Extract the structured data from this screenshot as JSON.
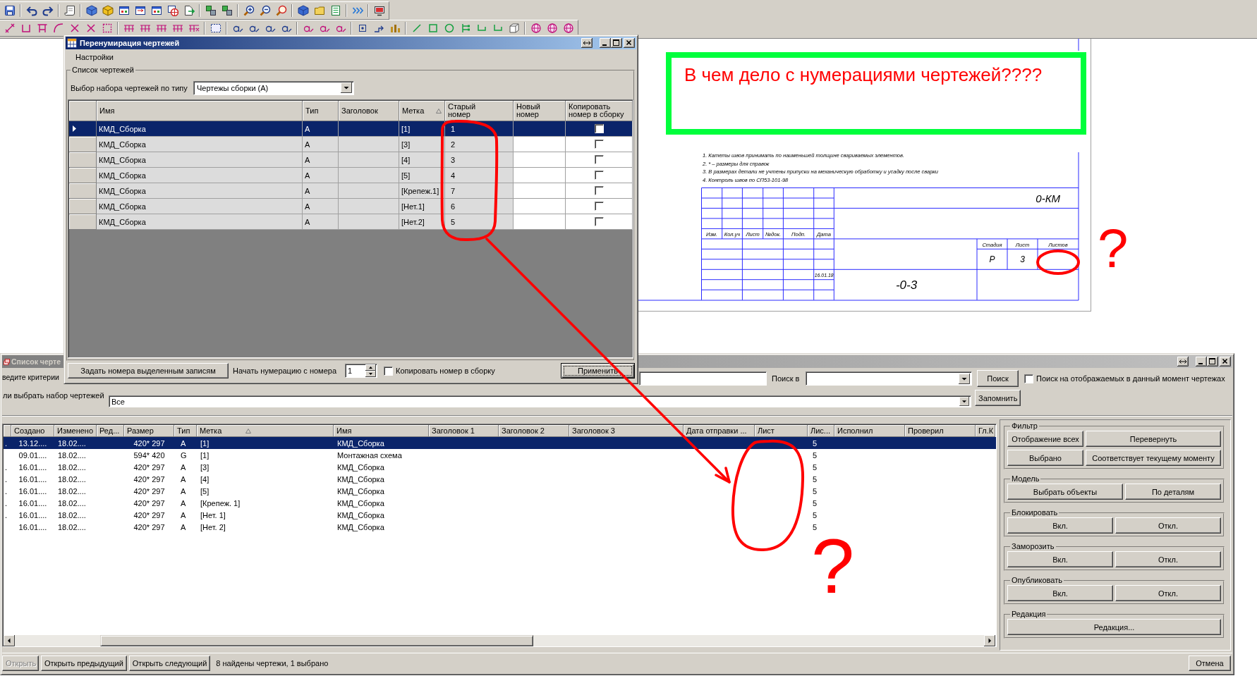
{
  "drawing_sheet": {
    "notes": [
      "1. Катеты швов принимать по наименьшей толщине свариваемых элементов.",
      "2. * – размеры для справок",
      "3. В размерах детали не учтены припуски на механическую обработку и усадку после сварки",
      "4. Контроль швов по СП53-101-98"
    ],
    "designation": "0-КМ",
    "revision_columns": [
      "Изм.",
      "Кол.уч",
      "Лист",
      "№док.",
      "Подп.",
      "Дата"
    ],
    "date": "16.01.18",
    "stage_columns": [
      "Стадия",
      "Лист",
      "Листов"
    ],
    "stage_values": [
      "Р",
      "3"
    ],
    "title": "-0-3"
  },
  "note": {
    "text": "В чем дело с нумерациями чертежей????"
  },
  "renumber_dialog": {
    "title": "Перенумирация чертежей",
    "active": true,
    "menu": [
      "Настройки"
    ],
    "group_title": "Список чертежей",
    "type_label": "Выбор набора чертежей по типу",
    "type_value": "Чертежы сборки (A)",
    "columns": [
      {
        "label": "Имя",
        "sorted": false
      },
      {
        "label": "Тип",
        "sorted": false
      },
      {
        "label": "Заголовок",
        "sorted": false
      },
      {
        "label": "Метка",
        "sorted": true
      },
      {
        "label": "Старый номер",
        "sorted": false
      },
      {
        "label": "Новый номер",
        "sorted": false
      },
      {
        "label": "Копировать номер в сборку",
        "sorted": false
      }
    ],
    "rows": [
      {
        "name": "КМД_Сборка",
        "type": "A",
        "label": "[1]",
        "old_number": "1",
        "copy": false,
        "selected": true
      },
      {
        "name": "КМД_Сборка",
        "type": "A",
        "label": "[3]",
        "old_number": "2",
        "copy": false,
        "selected": false
      },
      {
        "name": "КМД_Сборка",
        "type": "A",
        "label": "[4]",
        "old_number": "3",
        "copy": false,
        "selected": false
      },
      {
        "name": "КМД_Сборка",
        "type": "A",
        "label": "[5]",
        "old_number": "4",
        "copy": false,
        "selected": false
      },
      {
        "name": "КМД_Сборка",
        "type": "A",
        "label": "[Крепеж.1]",
        "old_number": "7",
        "copy": false,
        "selected": false
      },
      {
        "name": "КМД_Сборка",
        "type": "A",
        "label": "[Нет.1]",
        "old_number": "6",
        "copy": false,
        "selected": false
      },
      {
        "name": "КМД_Сборка",
        "type": "A",
        "label": "[Нет.2]",
        "old_number": "5",
        "copy": false,
        "selected": false
      }
    ],
    "assign_button": "Задать номера выделенным записям",
    "start_label": "Начать нумерацию с номера",
    "start_value": "1",
    "copy_option": {
      "label": "Копировать номер в сборку",
      "checked": false
    },
    "apply_button": {
      "label": "Применить",
      "focused": true
    }
  },
  "drawings_list": {
    "title": "Список черте",
    "active": false,
    "criteria_label": "ведите критерии",
    "search_in_label": "Поиск в",
    "search_button": "Поиск",
    "visible_only": {
      "label": "Поиск на отображаемых в данный момент чертежах",
      "checked": false
    },
    "set_label": "ли выбрать набор чертежей",
    "set_value": "Все",
    "remember_button": "Запомнить",
    "columns": [
      {
        "label": "Создано",
        "sorted": false
      },
      {
        "label": "Изменено",
        "sorted": false
      },
      {
        "label": "Ред...",
        "sorted": false
      },
      {
        "label": "Размер",
        "sorted": false
      },
      {
        "label": "Тип",
        "sorted": false
      },
      {
        "label": "Метка",
        "sorted": true
      },
      {
        "label": "Имя",
        "sorted": false
      },
      {
        "label": "Заголовок 1",
        "sorted": false
      },
      {
        "label": "Заголовок 2",
        "sorted": false
      },
      {
        "label": "Заголовок 3",
        "sorted": false
      },
      {
        "label": "Дата отправки ...",
        "sorted": false
      },
      {
        "label": "Лист",
        "sorted": false
      },
      {
        "label": "Лис...",
        "sorted": false
      },
      {
        "label": "Исполнил",
        "sorted": false
      },
      {
        "label": "Проверил",
        "sorted": false
      },
      {
        "label": "Гл.К",
        "sorted": false
      }
    ],
    "rows": [
      {
        "column_1": ".",
        "created": "13.12....",
        "modified": "18.02....",
        "size": "420* 297",
        "type": "A",
        "label": "[1]",
        "name": "КМД_Сборка",
        "sheets": "5",
        "selected": true
      },
      {
        "created": "09.01....",
        "modified": "18.02....",
        "size": "594* 420",
        "type": "G",
        "label": "[1]",
        "name": "Монтажная схема",
        "sheets": "5",
        "selected": false
      },
      {
        "column_1": ".",
        "created": "16.01....",
        "modified": "18.02....",
        "size": "420* 297",
        "type": "A",
        "label": "[3]",
        "name": "КМД_Сборка",
        "sheets": "5",
        "selected": false
      },
      {
        "column_1": ".",
        "created": "16.01....",
        "modified": "18.02....",
        "size": "420* 297",
        "type": "A",
        "label": "[4]",
        "name": "КМД_Сборка",
        "sheets": "5",
        "selected": false
      },
      {
        "column_1": ".",
        "created": "16.01....",
        "modified": "18.02....",
        "size": "420* 297",
        "type": "A",
        "label": "[5]",
        "name": "КМД_Сборка",
        "sheets": "5",
        "selected": false
      },
      {
        "column_1": ".",
        "created": "16.01....",
        "modified": "18.02....",
        "size": "420* 297",
        "type": "A",
        "label": "[Крепеж. 1]",
        "name": "КМД_Сборка",
        "sheets": "5",
        "selected": false
      },
      {
        "column_1": ".",
        "created": "16.01....",
        "modified": "18.02....",
        "size": "420* 297",
        "type": "A",
        "label": "[Нет. 1]",
        "name": "КМД_Сборка",
        "sheets": "5",
        "selected": false
      },
      {
        "created": "16.01....",
        "modified": "18.02....",
        "size": "420* 297",
        "type": "A",
        "label": "[Нет. 2]",
        "name": "КМД_Сборка",
        "sheets": "5",
        "selected": false
      }
    ],
    "panel": [
      {
        "title": "Фильтр",
        "buttons": [
          "Отображение всех",
          "Перевернуть",
          "Выбрано",
          "Соответствует текущему моменту"
        ]
      },
      {
        "title": "Модель",
        "buttons": [
          "Выбрать объекты",
          "По деталям"
        ]
      },
      {
        "title": "Блокировать",
        "buttons": [
          "Вкл.",
          "Откл."
        ]
      },
      {
        "title": "Заморозить",
        "buttons": [
          "Вкл.",
          "Откл."
        ]
      },
      {
        "title": "Опубликовать",
        "buttons": [
          "Вкл.",
          "Откл."
        ]
      },
      {
        "title": "Редакция",
        "buttons": [
          "Редакция..."
        ]
      }
    ],
    "footer_buttons": [
      {
        "label": "Открыть",
        "disabled": true
      },
      {
        "label": "Открыть предыдущий",
        "disabled": false
      },
      {
        "label": "Открыть следующий",
        "disabled": false
      }
    ],
    "status": "8 найдены чертежи, 1 выбрано",
    "cancel_button": "Отмена"
  },
  "annotations": {
    "question_marks": [
      "?",
      "?"
    ]
  }
}
